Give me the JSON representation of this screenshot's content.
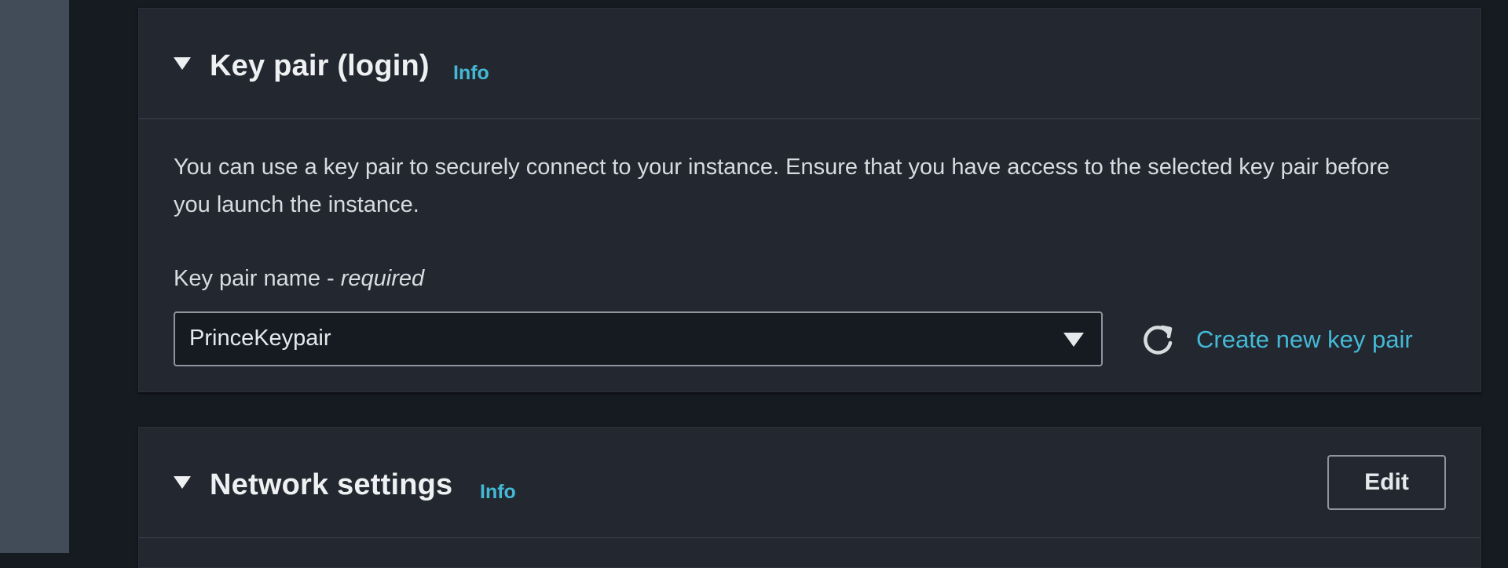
{
  "keypair_section": {
    "title": "Key pair (login)",
    "info_label": "Info",
    "description": "You can use a key pair to securely connect to your instance. Ensure that you have access to the selected key pair before you launch the instance.",
    "field_label": "Key pair name - ",
    "field_required": "required",
    "selected_value": "PrinceKeypair",
    "create_link": "Create new key pair"
  },
  "network_section": {
    "title": "Network settings",
    "info_label": "Info",
    "edit_button": "Edit"
  },
  "icons": {
    "caret": "caret-down-icon",
    "select_caret": "dropdown-caret-icon",
    "refresh": "refresh-icon"
  },
  "colors": {
    "accent_link": "#44b9d6",
    "panel_bg": "#232830",
    "page_bg": "#161a21"
  }
}
